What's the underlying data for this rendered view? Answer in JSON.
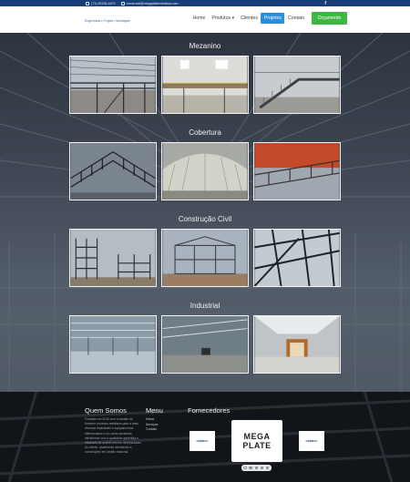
{
  "topbar": {
    "phone": "(71) 99135-4470",
    "email": "comercial@megaplatemetalica.com",
    "social": "f"
  },
  "header": {
    "logo_text": "Engenharia • Projeto • Montagem"
  },
  "nav": {
    "items": [
      "Home",
      "Produtos",
      "Clientes",
      "Projetos",
      "Contato"
    ],
    "dropdown_caret": "▾",
    "cta": "Orçamento",
    "active_index": 3
  },
  "sections": [
    {
      "title": "Mezanino",
      "images": [
        "mezanino-estrutura-metalica",
        "mezanino-galpao-interno",
        "escada-mezanino-metalico"
      ]
    },
    {
      "title": "Cobertura",
      "images": [
        "trelicas-cobertura",
        "cobertura-galpao-arco",
        "estrutura-telhado-metalico"
      ]
    },
    {
      "title": "Construção Civil",
      "images": [
        "estrutura-predio-metalico",
        "obra-construcao-civil",
        "vigas-metalicas-montagem"
      ]
    },
    {
      "title": "Industrial",
      "images": [
        "galpao-industrial-vazio",
        "galpao-industrial-estrutura",
        "galpao-industrial-portao"
      ]
    }
  ],
  "footer": {
    "about_title": "Quem Somos",
    "about_text": "Fundada em 2016 com a missão de fornecer produtos metálicos para a mais diversas finalidades e equipamentos diferenciados a um custo acessível, atendemos com a qualidade garantida e eficiência de acordo com as necessidades do cliente, atualmente atendendo a construções em âmbito nacional.",
    "menu_title": "Menu",
    "menu_items": [
      "Home",
      "Serviços",
      "Contato"
    ],
    "suppliers_title": "Fornecedores",
    "suppliers": [
      "GERDAU",
      "MEGA PLATE",
      "GERDAU"
    ],
    "carousel_active": 0,
    "carousel_count": 5
  },
  "colors": {
    "topbar": "#1b3d77",
    "active_nav": "#2b8ed8",
    "cta": "#3fb743",
    "footer": "#111418"
  }
}
